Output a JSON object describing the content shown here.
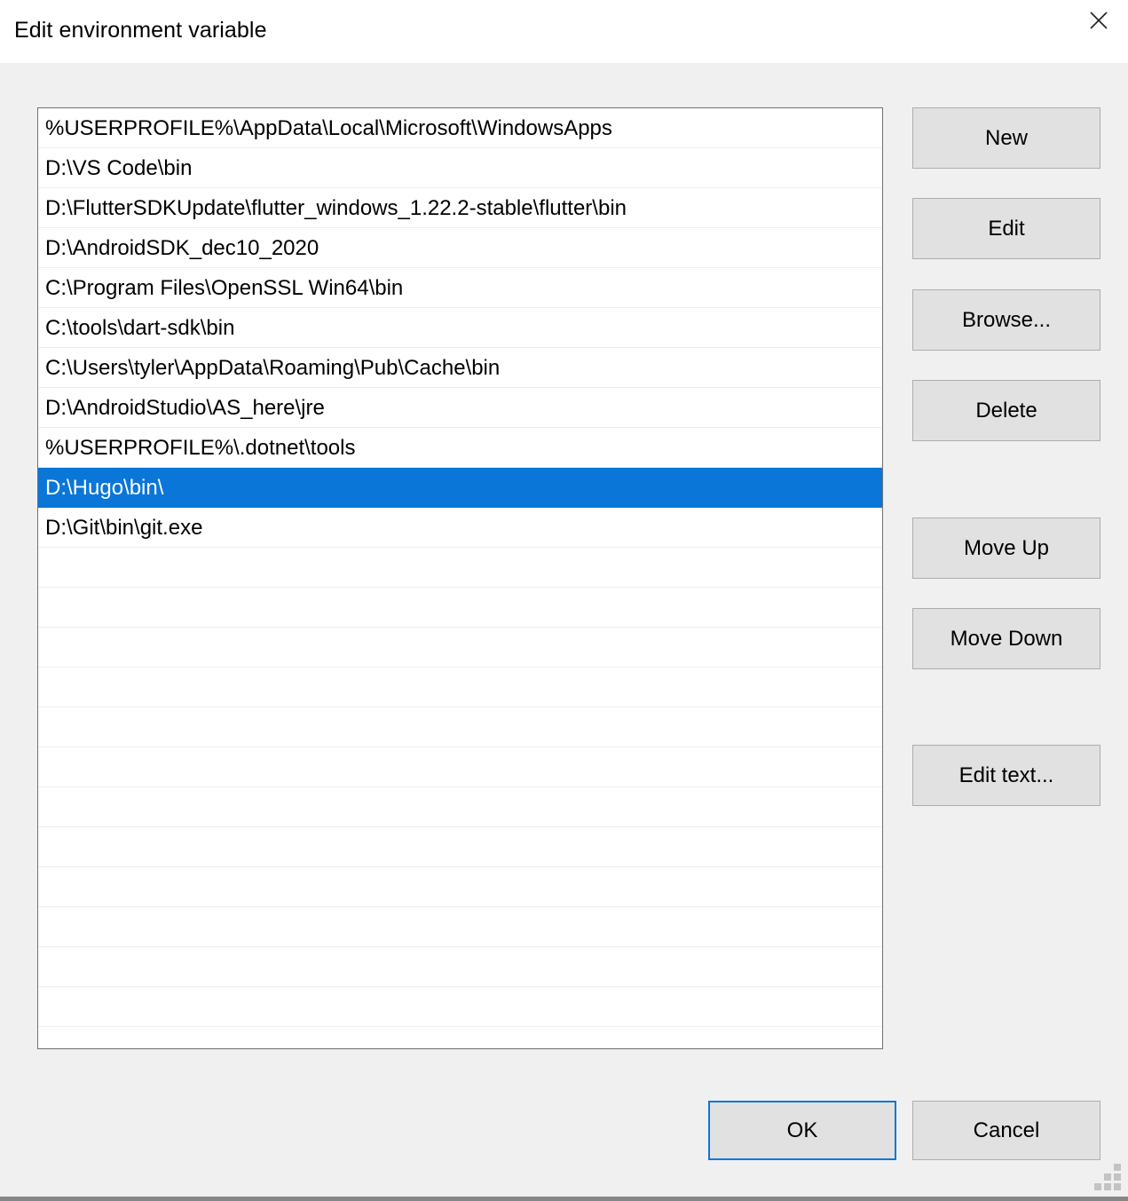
{
  "window": {
    "title": "Edit environment variable",
    "close_icon": "close-icon"
  },
  "list": {
    "items": [
      "%USERPROFILE%\\AppData\\Local\\Microsoft\\WindowsApps",
      "D:\\VS Code\\bin",
      "D:\\FlutterSDKUpdate\\flutter_windows_1.22.2-stable\\flutter\\bin",
      "D:\\AndroidSDK_dec10_2020",
      "C:\\Program Files\\OpenSSL Win64\\bin",
      "C:\\tools\\dart-sdk\\bin",
      "C:\\Users\\tyler\\AppData\\Roaming\\Pub\\Cache\\bin",
      "D:\\AndroidStudio\\AS_here\\jre",
      "%USERPROFILE%\\.dotnet\\tools",
      "D:\\Hugo\\bin\\",
      "D:\\Git\\bin\\git.exe"
    ],
    "selected_index": 9,
    "empty_row_count": 12,
    "selection_color": "#0a76d8",
    "selection_text_color": "#ffffff"
  },
  "side_buttons": [
    {
      "id": "new",
      "label": "New"
    },
    {
      "id": "edit",
      "label": "Edit"
    },
    {
      "id": "browse",
      "label": "Browse..."
    },
    {
      "id": "delete",
      "label": "Delete"
    },
    {
      "id": "move_up",
      "label": "Move Up"
    },
    {
      "id": "move_down",
      "label": "Move Down"
    },
    {
      "id": "edit_text",
      "label": "Edit text..."
    }
  ],
  "footer": {
    "ok_label": "OK",
    "cancel_label": "Cancel",
    "ok_focus_color": "#0a76d8"
  },
  "grip": {
    "name": "resize-grip"
  }
}
